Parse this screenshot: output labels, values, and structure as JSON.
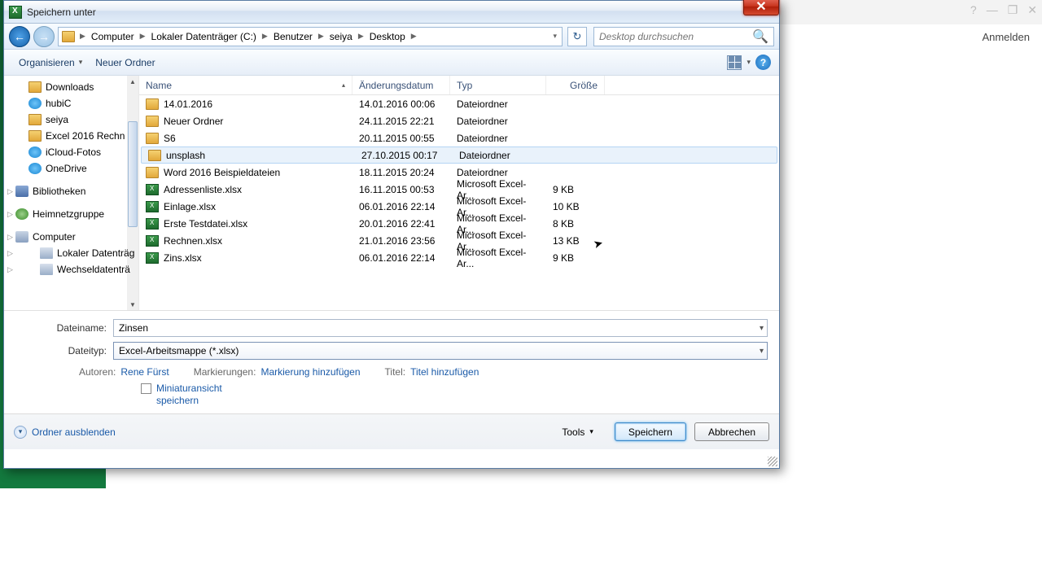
{
  "bg": {
    "login": "Anmelden",
    "help": "?",
    "min": "—",
    "max": "❐",
    "close": "✕"
  },
  "dialog": {
    "title": "Speichern unter",
    "close": "✕",
    "nav": {
      "back": "←",
      "fwd": "→",
      "refresh": "↻",
      "search_placeholder": "Desktop durchsuchen",
      "mag": "🔍"
    },
    "breadcrumb": [
      "Computer",
      "Lokaler Datenträger (C:)",
      "Benutzer",
      "seiya",
      "Desktop"
    ],
    "toolbar": {
      "organize": "Organisieren",
      "newfolder": "Neuer Ordner",
      "help": "?"
    },
    "tree": {
      "items": [
        {
          "label": "Downloads",
          "ico": "folder",
          "lvl": "tnode"
        },
        {
          "label": "hubiC",
          "ico": "cloud",
          "lvl": "tnode"
        },
        {
          "label": "seiya",
          "ico": "folder",
          "lvl": "tnode"
        },
        {
          "label": "Excel 2016 Rechn",
          "ico": "folder",
          "lvl": "tnode"
        },
        {
          "label": "iCloud-Fotos",
          "ico": "cloud",
          "lvl": "tnode"
        },
        {
          "label": "OneDrive",
          "ico": "cloud",
          "lvl": "tnode"
        },
        {
          "label": "Bibliotheken",
          "ico": "lib",
          "lvl": "tnode grp"
        },
        {
          "label": "Heimnetzgruppe",
          "ico": "net",
          "lvl": "tnode grp"
        },
        {
          "label": "Computer",
          "ico": "pc",
          "lvl": "tnode grp"
        },
        {
          "label": "Lokaler Datenträg",
          "ico": "drive",
          "lvl": "tnode sub"
        },
        {
          "label": "Wechseldatenträ",
          "ico": "drive",
          "lvl": "tnode sub"
        }
      ]
    },
    "columns": {
      "name": "Name",
      "date": "Änderungsdatum",
      "type": "Typ",
      "size": "Größe"
    },
    "files": [
      {
        "name": "14.01.2016",
        "date": "14.01.2016 00:06",
        "type": "Dateiordner",
        "size": "",
        "ico": "folder"
      },
      {
        "name": "Neuer Ordner",
        "date": "24.11.2015 22:21",
        "type": "Dateiordner",
        "size": "",
        "ico": "folder"
      },
      {
        "name": "S6",
        "date": "20.11.2015 00:55",
        "type": "Dateiordner",
        "size": "",
        "ico": "folder"
      },
      {
        "name": "unsplash",
        "date": "27.10.2015 00:17",
        "type": "Dateiordner",
        "size": "",
        "ico": "folder",
        "hover": true
      },
      {
        "name": "Word 2016 Beispieldateien",
        "date": "18.11.2015 20:24",
        "type": "Dateiordner",
        "size": "",
        "ico": "folder"
      },
      {
        "name": "Adressenliste.xlsx",
        "date": "16.11.2015 00:53",
        "type": "Microsoft Excel-Ar...",
        "size": "9 KB",
        "ico": "xlsx"
      },
      {
        "name": "Einlage.xlsx",
        "date": "06.01.2016 22:14",
        "type": "Microsoft Excel-Ar...",
        "size": "10 KB",
        "ico": "xlsx"
      },
      {
        "name": "Erste Testdatei.xlsx",
        "date": "20.01.2016 22:41",
        "type": "Microsoft Excel-Ar...",
        "size": "8 KB",
        "ico": "xlsx"
      },
      {
        "name": "Rechnen.xlsx",
        "date": "21.01.2016 23:56",
        "type": "Microsoft Excel-Ar...",
        "size": "13 KB",
        "ico": "xlsx"
      },
      {
        "name": "Zins.xlsx",
        "date": "06.01.2016 22:14",
        "type": "Microsoft Excel-Ar...",
        "size": "9 KB",
        "ico": "xlsx"
      }
    ],
    "form": {
      "filename_label": "Dateiname:",
      "filename": "Zinsen",
      "filetype_label": "Dateityp:",
      "filetype": "Excel-Arbeitsmappe (*.xlsx)",
      "author_label": "Autoren:",
      "author": "Rene Fürst",
      "tags_label": "Markierungen:",
      "tags": "Markierung hinzufügen",
      "title_label": "Titel:",
      "title": "Titel hinzufügen",
      "thumb": "Miniaturansicht speichern"
    },
    "footer": {
      "hide": "Ordner ausblenden",
      "tools": "Tools",
      "save": "Speichern",
      "cancel": "Abbrechen"
    }
  }
}
